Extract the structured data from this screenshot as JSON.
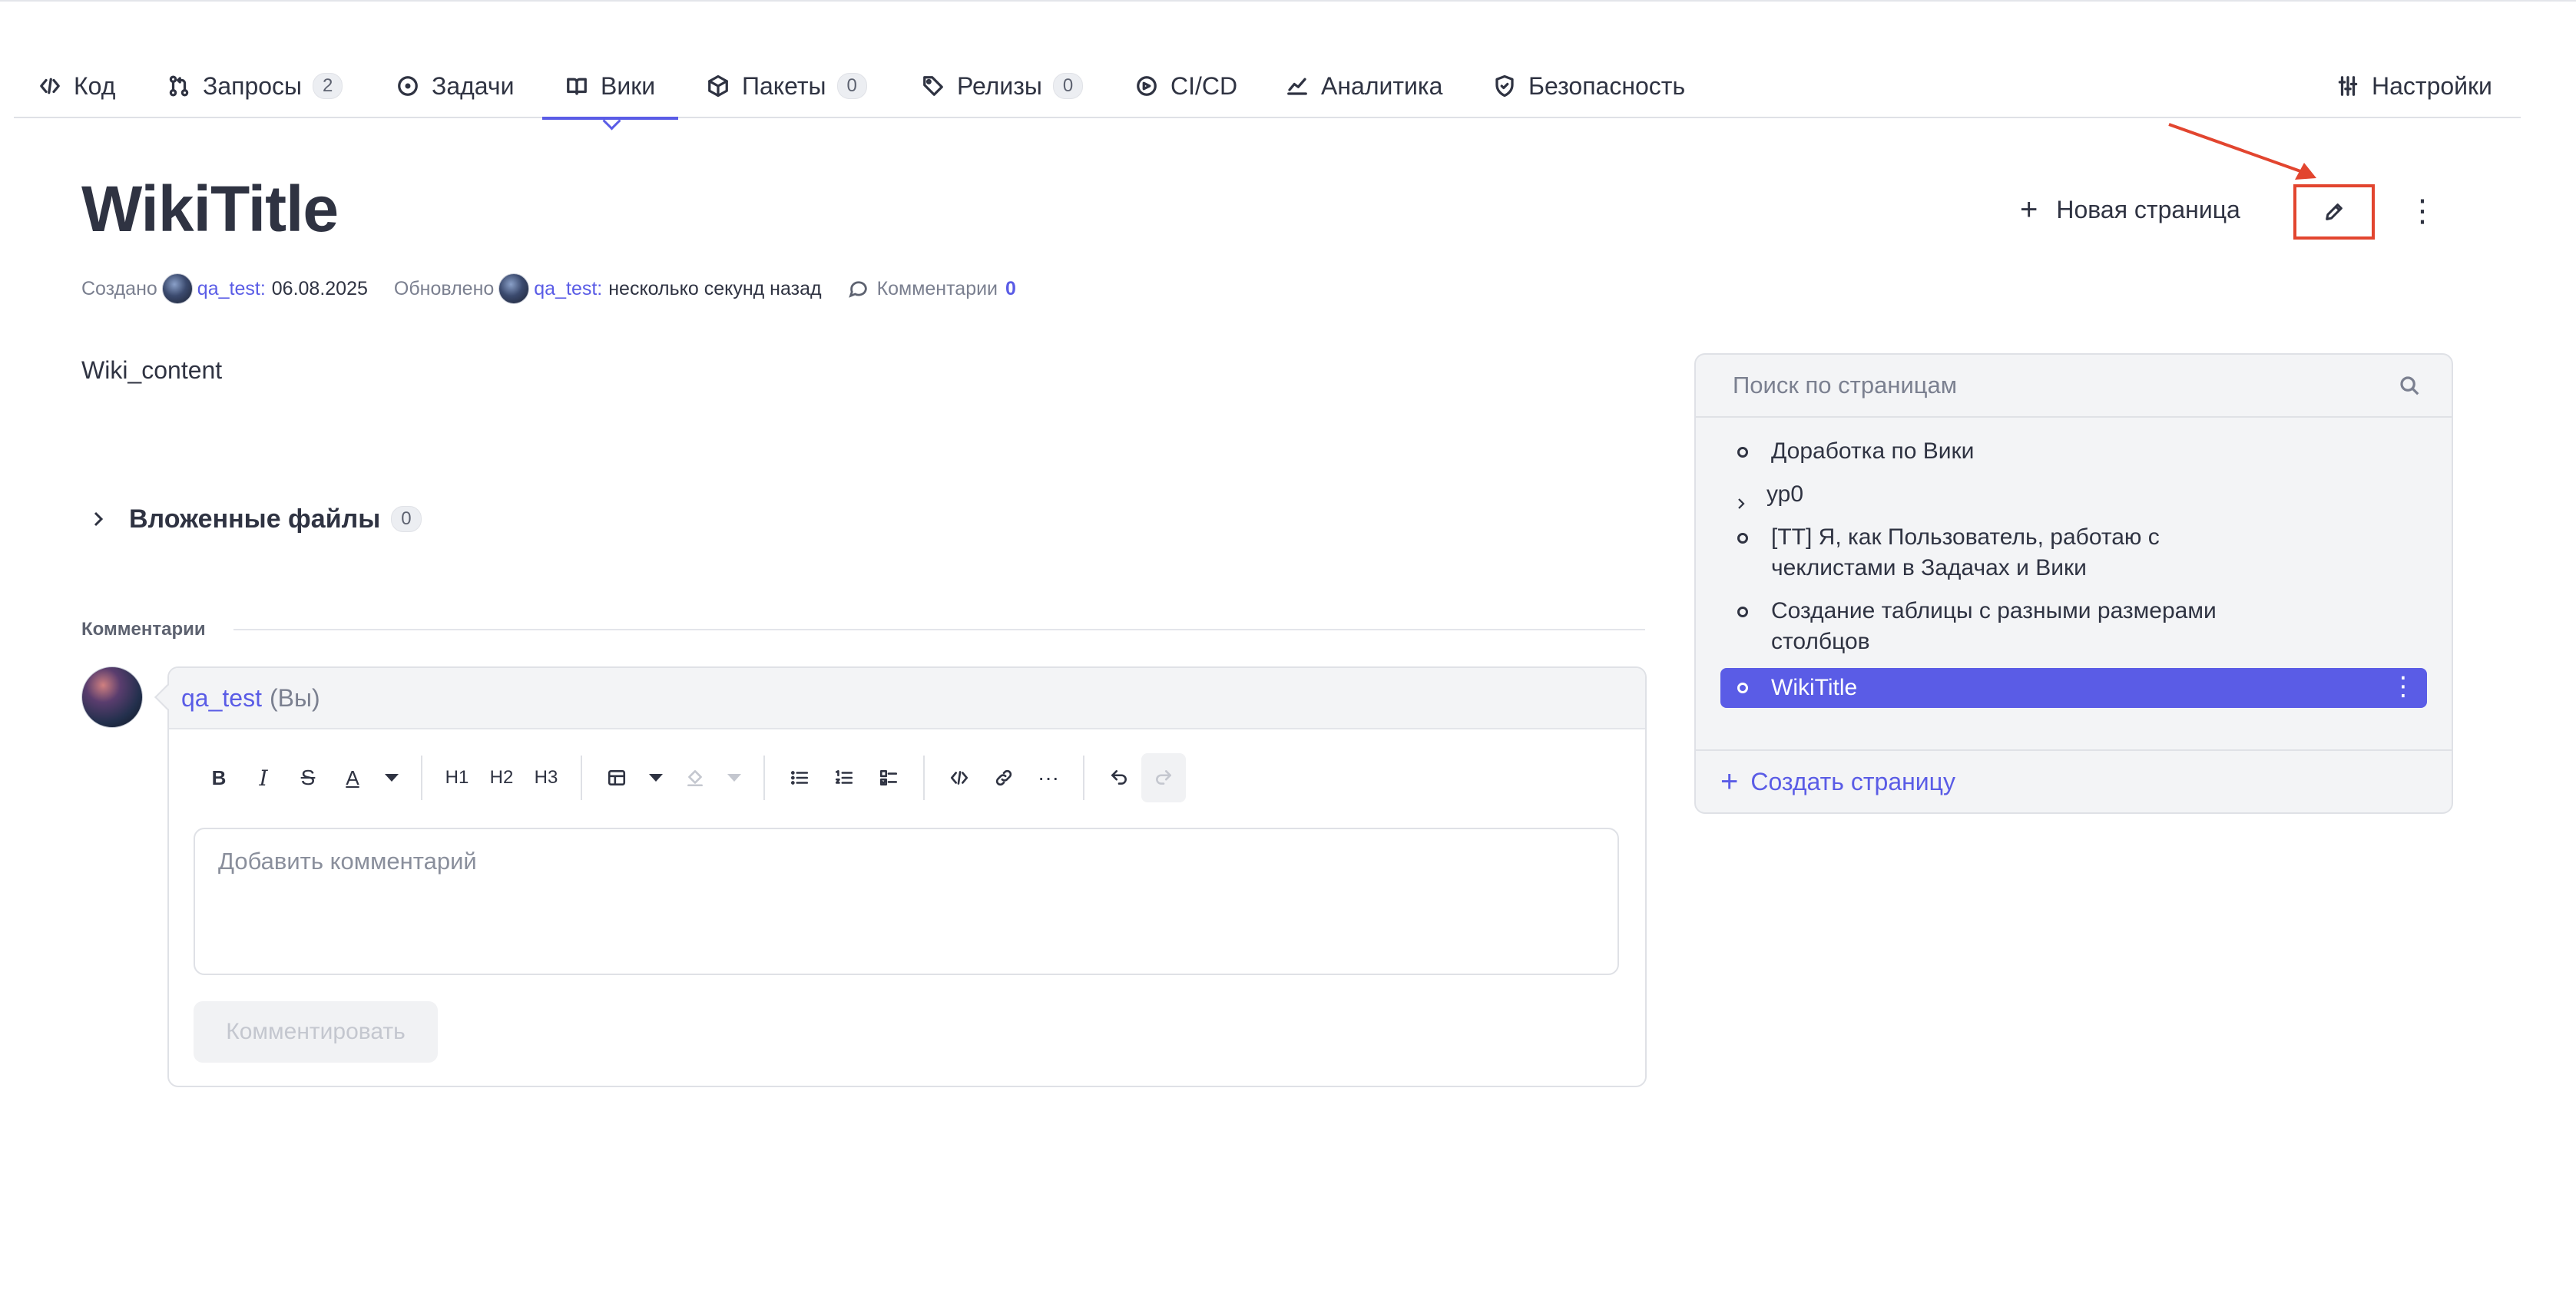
{
  "tabs": [
    {
      "label": "Код",
      "icon": "code-icon"
    },
    {
      "label": "Запросы",
      "icon": "pull-request-icon",
      "count": "2"
    },
    {
      "label": "Задачи",
      "icon": "issue-circle-icon"
    },
    {
      "label": "Вики",
      "icon": "book-icon",
      "active": true
    },
    {
      "label": "Пакеты",
      "icon": "package-icon",
      "count": "0"
    },
    {
      "label": "Релизы",
      "icon": "tag-icon",
      "count": "0"
    },
    {
      "label": "CI/CD",
      "icon": "pipeline-icon"
    },
    {
      "label": "Аналитика",
      "icon": "chart-icon"
    },
    {
      "label": "Безопасность",
      "icon": "shield-icon"
    },
    {
      "label": "Настройки",
      "icon": "sliders-icon"
    }
  ],
  "page": {
    "title": "WikiTitle",
    "new_page_label": "Новая страница",
    "content": "Wiki_content"
  },
  "meta": {
    "created_label": "Создано",
    "created_user": "qa_test",
    "created_date": "06.08.2025",
    "updated_label": "Обновлено",
    "updated_user": "qa_test",
    "updated_time": "несколько секунд назад",
    "comments_label": "Комментарии",
    "comments_count": "0"
  },
  "attachments": {
    "label": "Вложенные файлы",
    "count": "0"
  },
  "comments": {
    "section_title": "Комментарии",
    "author": "qa_test",
    "author_suffix": "(Вы)",
    "placeholder": "Добавить комментарий",
    "submit_label": "Комментировать",
    "toolbar": {
      "h1": "H1",
      "h2": "H2",
      "h3": "H3",
      "more": "···"
    }
  },
  "sidebar": {
    "search_placeholder": "Поиск по страницам",
    "items": [
      {
        "label": "Доработка по Вики",
        "kind": "page"
      },
      {
        "label": "ур0",
        "kind": "folder"
      },
      {
        "label": "[ТТ] Я, как Пользователь, работаю с чеклистами в Задачах и Вики",
        "kind": "page"
      },
      {
        "label": "Создание таблицы с разными размерами столбцов",
        "kind": "page"
      },
      {
        "label": "WikiTitle",
        "kind": "page",
        "active": true
      }
    ],
    "create_label": "Создать страницу"
  },
  "colors": {
    "accent": "#5a5ce6",
    "annotation_red": "#e2452f",
    "text": "#2f3342",
    "muted": "#7b8090"
  }
}
